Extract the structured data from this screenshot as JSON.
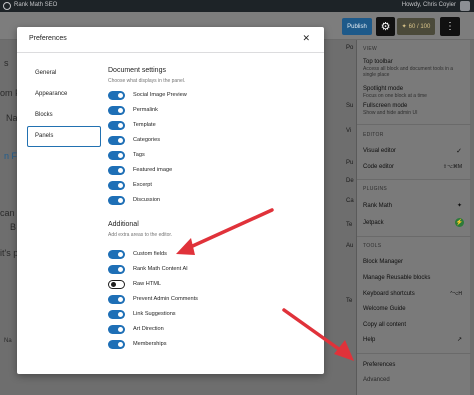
{
  "admin_bar": {
    "site_label": "Rank Math SEO",
    "user_greeting": "Howdy, Chris Coyier"
  },
  "toolbar": {
    "publish_label": "Publish",
    "rank_math_score": "60 / 100",
    "settings_icon": "gear-icon",
    "more_icon": "vertical-ellipsis-icon"
  },
  "background_fragments": {
    "left": [
      "s",
      "om F",
      "Na",
      "n Fie",
      "can b",
      "B",
      "it's p",
      "Na"
    ],
    "right": [
      "Po",
      "Su",
      "Vi",
      "Pu",
      "Te",
      "Au",
      "De",
      "Ca",
      "Te"
    ]
  },
  "modal": {
    "title": "Preferences",
    "close_icon": "close-icon",
    "tabs": [
      {
        "label": "General",
        "active": false
      },
      {
        "label": "Appearance",
        "active": false
      },
      {
        "label": "Blocks",
        "active": false
      },
      {
        "label": "Panels",
        "active": true
      }
    ],
    "document_settings": {
      "title": "Document settings",
      "description": "Choose what displays in the panel.",
      "options": [
        {
          "label": "Social Image Preview",
          "enabled": true
        },
        {
          "label": "Permalink",
          "enabled": true
        },
        {
          "label": "Template",
          "enabled": true
        },
        {
          "label": "Categories",
          "enabled": true
        },
        {
          "label": "Tags",
          "enabled": true
        },
        {
          "label": "Featured image",
          "enabled": true
        },
        {
          "label": "Excerpt",
          "enabled": true
        },
        {
          "label": "Discussion",
          "enabled": true
        }
      ]
    },
    "additional": {
      "title": "Additional",
      "description": "Add extra areas to the editor.",
      "options": [
        {
          "label": "Custom fields",
          "enabled": true
        },
        {
          "label": "Rank Math Content AI",
          "enabled": true
        },
        {
          "label": "Raw HTML",
          "enabled": false
        },
        {
          "label": "Prevent Admin Comments",
          "enabled": true
        },
        {
          "label": "Link Suggestions",
          "enabled": true
        },
        {
          "label": "Art Direction",
          "enabled": true
        },
        {
          "label": "Memberships",
          "enabled": true
        }
      ]
    }
  },
  "more_menu": {
    "view_heading": "VIEW",
    "top_toolbar": {
      "label": "Top toolbar",
      "description": "Access all block and document tools in a single place"
    },
    "spotlight": {
      "label": "Spotlight mode",
      "description": "Focus on one block at a time"
    },
    "fullscreen": {
      "label": "Fullscreen mode",
      "description": "Show and hide admin UI"
    },
    "editor_heading": "EDITOR",
    "visual_editor": "Visual editor",
    "code_editor": "Code editor",
    "code_editor_shortcut": "⇧⌥⌘M",
    "plugins_heading": "PLUGINS",
    "rank_math": "Rank Math",
    "jetpack": "Jetpack",
    "tools_heading": "TOOLS",
    "block_manager": "Block Manager",
    "reusable_blocks": "Manage Reusable blocks",
    "keyboard_shortcuts": "Keyboard shortcuts",
    "keyboard_shortcuts_key": "^⌥H",
    "welcome_guide": "Welcome Guide",
    "copy_all": "Copy all content",
    "help": "Help",
    "preferences": "Preferences",
    "bottom_partial": "Advanced"
  },
  "colors": {
    "accent": "#1e6fb6",
    "arrow": "#e0323a",
    "publish": "#1e5a8a"
  }
}
